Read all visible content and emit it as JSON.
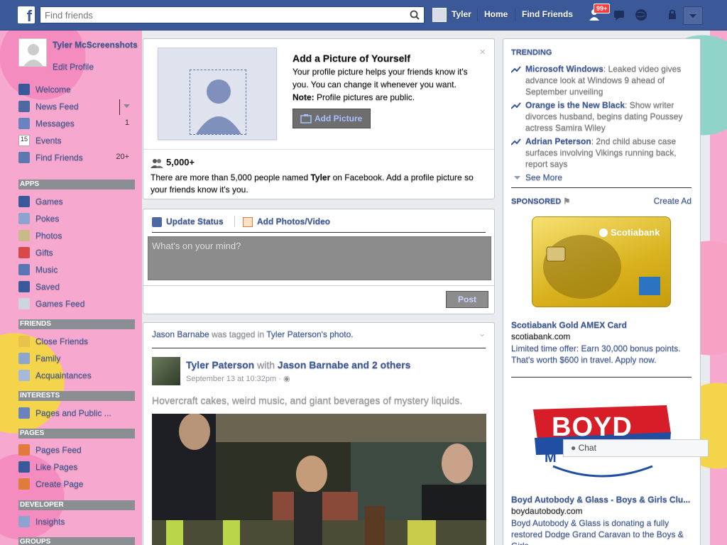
{
  "topbar": {
    "search_placeholder": "Find friends",
    "user_name": "Tyler",
    "home_label": "Home",
    "find_friends_label": "Find Friends",
    "notif_count": "99+"
  },
  "leftnav": {
    "profile_name": "Tyler McScreenshots",
    "edit_profile": "Edit Profile",
    "items": [
      {
        "label": "Welcome",
        "icon": "facebook-icon",
        "count": ""
      },
      {
        "label": "News Feed",
        "icon": "news-feed-icon",
        "count": ""
      },
      {
        "label": "Messages",
        "icon": "messages-icon",
        "count": "1"
      },
      {
        "label": "Events",
        "icon": "calendar-icon",
        "count": ""
      },
      {
        "label": "Find Friends",
        "icon": "find-friends-icon",
        "count": "20+"
      }
    ],
    "apps_header": "APPS",
    "apps": [
      "Games",
      "Pokes",
      "Photos",
      "Gifts",
      "Music",
      "Saved",
      "Games Feed"
    ],
    "friends_header": "FRIENDS",
    "friends": [
      "Close Friends",
      "Family",
      "Acquaintances"
    ],
    "interests_header": "INTERESTS",
    "interests": [
      "Pages and Public ..."
    ],
    "pages_header": "PAGES",
    "pages": [
      "Pages Feed",
      "Like Pages",
      "Create Page"
    ],
    "developer_header": "DEVELOPER",
    "developer": [
      "Insights"
    ],
    "groups_header": "GROUPS"
  },
  "addpic": {
    "title": "Add a Picture of Yourself",
    "desc": "Your profile picture helps your friends know it's you. You can change it whenever you want.",
    "note_label": "Note:",
    "note_text": " Profile pictures are public.",
    "button": "Add Picture",
    "close": "×",
    "people_count": "5,000+",
    "people_desc_1": "There are more than 5,000 people named ",
    "people_name": "Tyler",
    "people_desc_2": " on Facebook. Add a profile picture so your friends know it's you."
  },
  "composer": {
    "update_status": "Update Status",
    "add_photos": "Add Photos/Video",
    "placeholder": "What's on your mind?",
    "post": "Post"
  },
  "feed": {
    "tagged_user": "Jason Barnabe",
    "tagged_mid": " was tagged in ",
    "tagged_target": "Tyler Paterson's photo.",
    "author": "Tyler Paterson",
    "with_text": " with ",
    "with_users": "Jason Barnabe and 2 others",
    "time": "September 13 at 10:32pm · ",
    "text": "Hovercraft cakes, weird music, and giant beverages of mystery liquids."
  },
  "trending": {
    "header": "TRENDING",
    "items": [
      {
        "title": "Microsoft Windows",
        "desc": ": Leaked video gives advance look at Windows 9 ahead of September unveiling"
      },
      {
        "title": "Orange is the New Black",
        "desc": ": Show writer divorces husband, begins dating Poussey actress Samira Wiley"
      },
      {
        "title": "Adrian Peterson",
        "desc": ": 2nd child abuse case surfaces involving Vikings running back, report says"
      }
    ],
    "see_more": "See More"
  },
  "sponsored": {
    "header": "SPONSORED",
    "create_ad": "Create Ad",
    "ads": [
      {
        "card_brand": "Scotiabank",
        "title": "Scotiabank Gold AMEX Card",
        "domain": "scotiabank.com",
        "desc": "Limited time offer: Earn 30,000 bonus points. That's worth $600 in travel. Apply now."
      },
      {
        "logo_text": "BOYD",
        "title": "Boyd Autobody & Glass - Boys & Girls Clu...",
        "domain": "boydautobody.com",
        "desc": "Boyd Autobody & Glass is donating a fully restored Dodge Grand Caravan to the Boys & Girls..."
      }
    ]
  },
  "chat": {
    "label": "Chat"
  },
  "colors": {
    "brand": "#3b5998",
    "badge": "#fa3e3e"
  }
}
